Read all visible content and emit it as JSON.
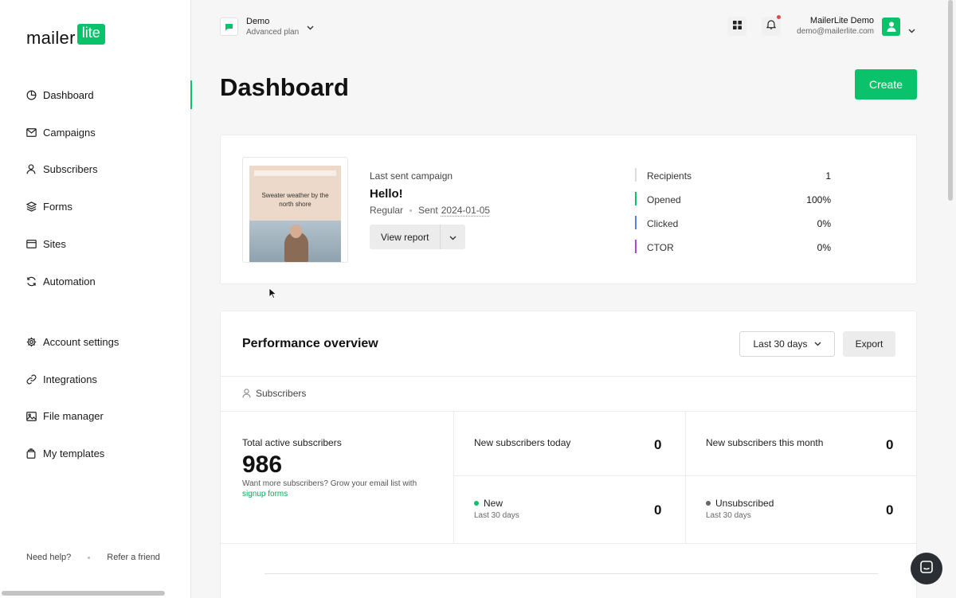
{
  "brand": {
    "logo_text": "mailer",
    "logo_badge": "lite",
    "accent": "#09c269"
  },
  "sidebar": {
    "primary": [
      {
        "label": "Dashboard",
        "icon": "dashboard-icon",
        "active": true
      },
      {
        "label": "Campaigns",
        "icon": "mail-icon"
      },
      {
        "label": "Subscribers",
        "icon": "user-icon"
      },
      {
        "label": "Forms",
        "icon": "layers-icon"
      },
      {
        "label": "Sites",
        "icon": "browser-icon"
      },
      {
        "label": "Automation",
        "icon": "refresh-icon"
      }
    ],
    "secondary": [
      {
        "label": "Account settings",
        "icon": "gear-icon"
      },
      {
        "label": "Integrations",
        "icon": "link-icon"
      },
      {
        "label": "File manager",
        "icon": "image-icon"
      },
      {
        "label": "My templates",
        "icon": "template-icon"
      }
    ],
    "footer": {
      "help": "Need help?",
      "refer": "Refer a friend"
    }
  },
  "header": {
    "account_name": "Demo",
    "account_plan": "Advanced plan",
    "user_name": "MailerLite Demo",
    "user_email": "demo@mailerlite.com"
  },
  "page": {
    "title": "Dashboard",
    "create_label": "Create"
  },
  "last_campaign": {
    "label": "Last sent campaign",
    "name": "Hello!",
    "type": "Regular",
    "sent_prefix": "Sent",
    "sent_date": "2024-01-05",
    "view_report_label": "View report",
    "thumbnail_title": "Sweater weather by the north shore",
    "stats": [
      {
        "name": "Recipients",
        "value": "1",
        "color": "#dcdcdc"
      },
      {
        "name": "Opened",
        "value": "100%",
        "color": "#09c269"
      },
      {
        "name": "Clicked",
        "value": "0%",
        "color": "#5b7cf0"
      },
      {
        "name": "CTOR",
        "value": "0%",
        "color": "#a74bd6"
      }
    ]
  },
  "performance": {
    "title": "Performance overview",
    "range": "Last 30 days",
    "export_label": "Export",
    "tab": "Subscribers",
    "total_label": "Total active subscribers",
    "total_value": "986",
    "hint_text": "Want more subscribers? Grow your email list with",
    "hint_link": "signup forms",
    "today_label": "New subscribers today",
    "today_value": "0",
    "month_label": "New subscribers this month",
    "month_value": "0",
    "new_label": "New",
    "new_sub": "Last 30 days",
    "new_value": "0",
    "new_color": "#09c269",
    "unsub_label": "Unsubscribed",
    "unsub_sub": "Last 30 days",
    "unsub_value": "0",
    "unsub_color": "#666666"
  }
}
